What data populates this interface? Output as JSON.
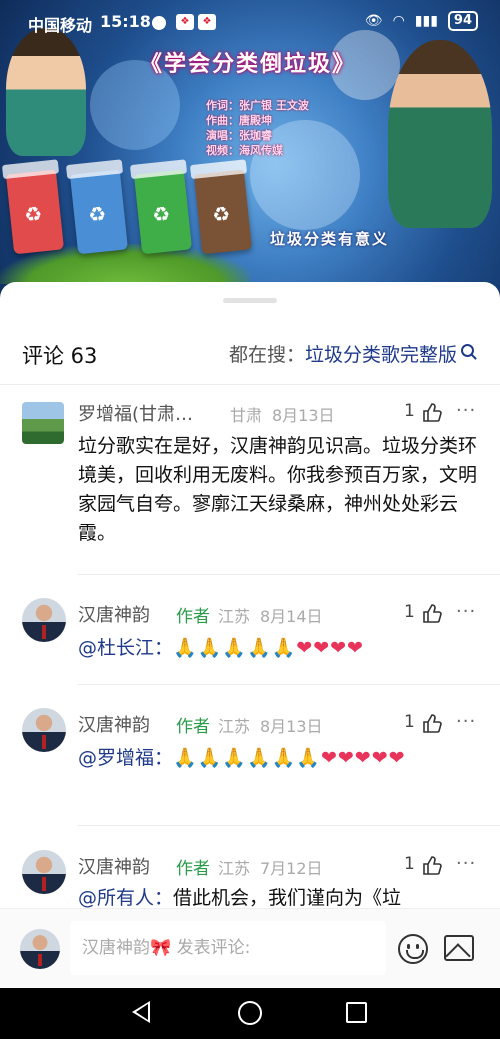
{
  "status_bar": {
    "carrier": "中国移动",
    "time": "15:18",
    "battery": "94"
  },
  "video": {
    "title": "《学会分类倒垃圾》",
    "credits": [
      "作词：张广银 王文波",
      "作曲：唐殿坤",
      "演唱：张珈睿",
      "视频：海风传媒"
    ],
    "subtitle": "垃圾分类有意义"
  },
  "comments_header": {
    "count_label": "评论 63",
    "hot_prefix": "都在搜：",
    "hot_query": "垃圾分类歌完整版"
  },
  "comments": [
    {
      "name": "罗增福(甘肃…",
      "author_tag": "",
      "location": "甘肃",
      "date": "8月13日",
      "likes": "1",
      "mention": "",
      "text": "垃分歌实在是好，汉唐神韵见识高。垃圾分类环境美，回收利用无废料。你我参预百万家，文明家园气自夸。寥廓江天绿桑麻，神州处处彩云霞。"
    },
    {
      "name": "汉唐神韵",
      "author_tag": "作者",
      "location": "江苏",
      "date": "8月14日",
      "likes": "1",
      "mention": "@杜长江：",
      "text": "🙏🙏🙏🙏🙏❤❤❤❤"
    },
    {
      "name": "汉唐神韵",
      "author_tag": "作者",
      "location": "江苏",
      "date": "8月13日",
      "likes": "1",
      "mention": "@罗增福：",
      "text": "🙏🙏🙏🙏🙏🙏❤❤❤❤❤"
    },
    {
      "name": "汉唐神韵",
      "author_tag": "作者",
      "location": "江苏",
      "date": "7月12日",
      "likes": "1",
      "mention": "@所有人：",
      "text": "借此机会，我们谨向为《垃"
    }
  ],
  "input_bar": {
    "user": "汉唐神韵",
    "bow": "🎀",
    "placeholder": "发表评论:"
  },
  "colors": {
    "mention": "#1f3a8a",
    "author_tag": "#2a9d4a",
    "hearts": "#e8335a"
  }
}
